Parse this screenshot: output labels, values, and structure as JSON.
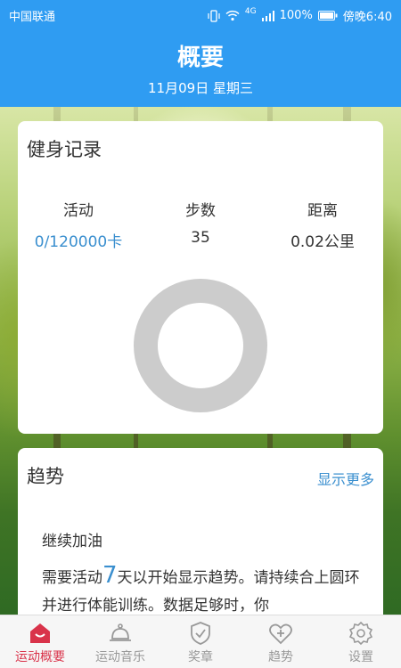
{
  "status_bar": {
    "carrier": "中国联通",
    "network": "4G",
    "battery": "100%",
    "time": "傍晚6:40"
  },
  "header": {
    "title": "概要",
    "date": "11月09日 星期三",
    "background_color": "#2f9cf2"
  },
  "fitness_card": {
    "title": "健身记录",
    "stats": [
      {
        "label": "活动",
        "value": "0/120000卡",
        "color": "#3a8fcf"
      },
      {
        "label": "步数",
        "value": "35"
      },
      {
        "label": "距离",
        "value": "0.02公里"
      }
    ],
    "ring_progress": 0,
    "ring_color": "#cccccc"
  },
  "trend_card": {
    "title": "趋势",
    "more_link": "显示更多",
    "encourage": "继续加油",
    "desc_prefix": "需要活动",
    "desc_days": "7",
    "desc_suffix": "天以开始显示趋势。请持续合上圆环并进行体能训练。数据足够时，你"
  },
  "nav": {
    "items": [
      {
        "label": "运动概要",
        "icon": "home-icon",
        "active": true
      },
      {
        "label": "运动音乐",
        "icon": "bell-icon"
      },
      {
        "label": "奖章",
        "icon": "medal-icon"
      },
      {
        "label": "趋势",
        "icon": "heart-plus-icon"
      },
      {
        "label": "设置",
        "icon": "gear-icon"
      }
    ],
    "active_color": "#d9334a"
  }
}
